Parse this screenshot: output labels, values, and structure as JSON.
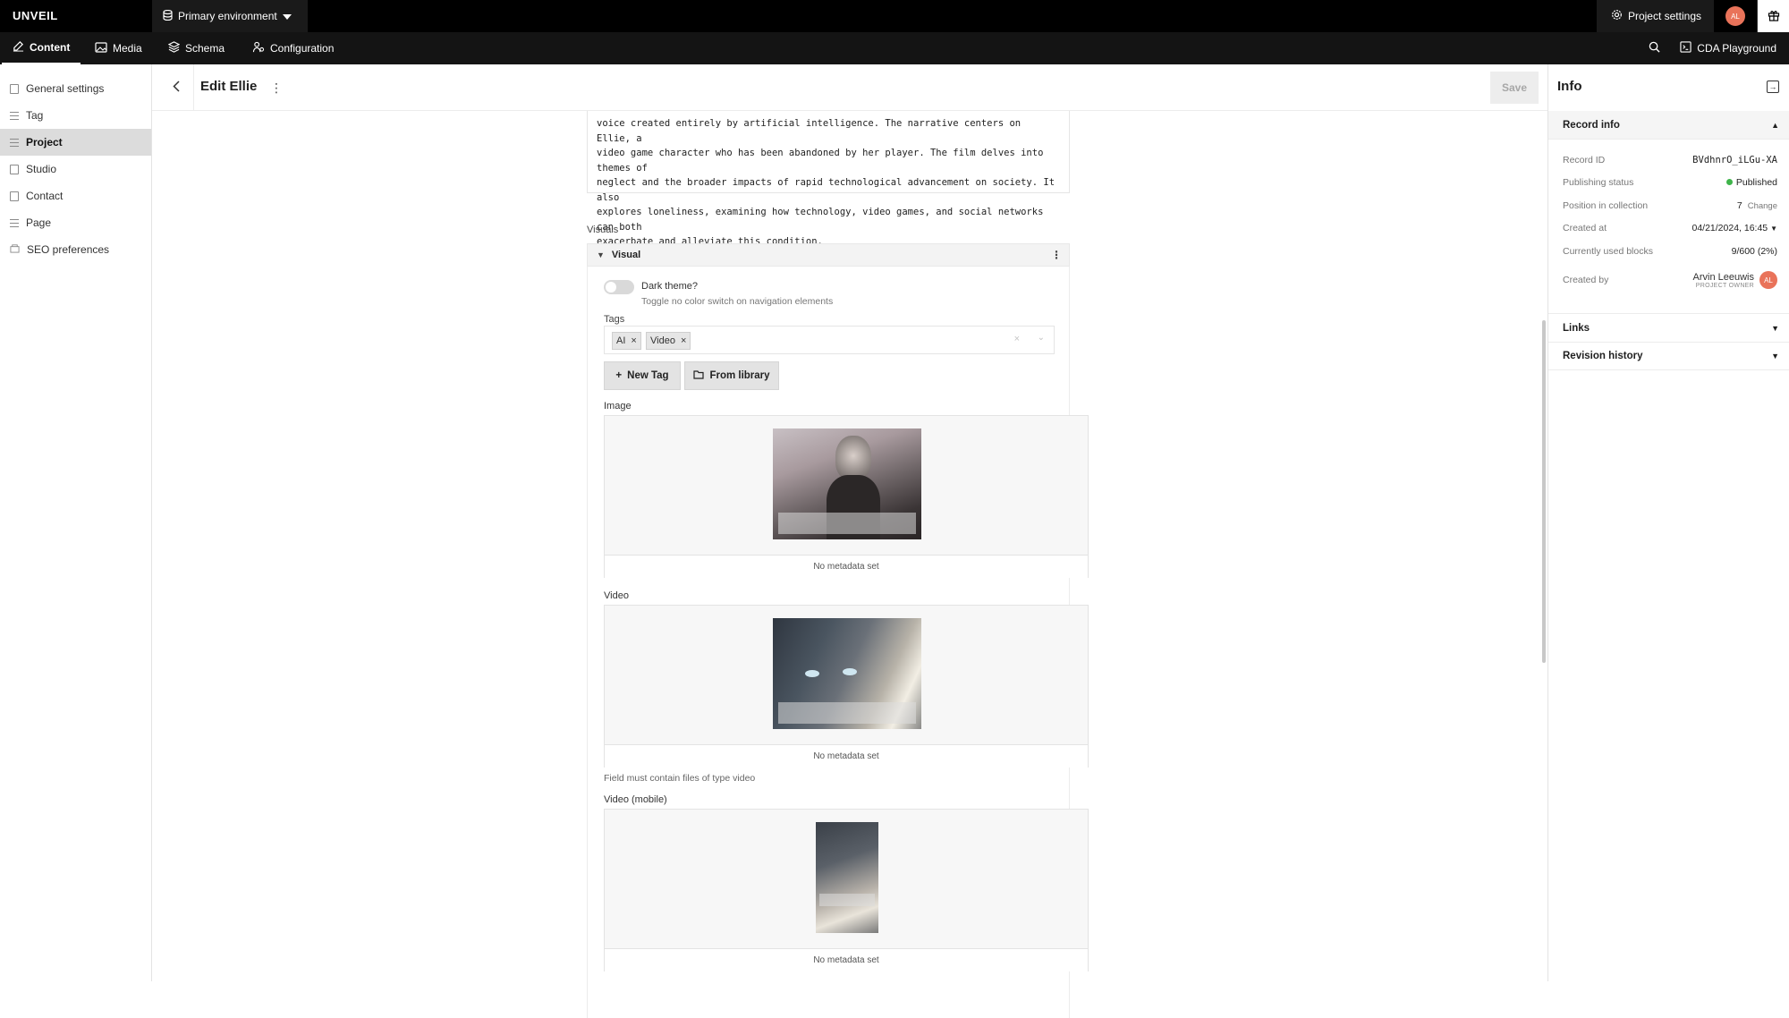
{
  "topbar": {
    "brand": "UNVEIL",
    "environment": "Primary environment",
    "project_settings": "Project settings",
    "avatar_initials": "AL"
  },
  "navbar": {
    "tabs": [
      {
        "label": "Content",
        "icon": "edit-icon"
      },
      {
        "label": "Media",
        "icon": "image-icon"
      },
      {
        "label": "Schema",
        "icon": "layers-icon"
      },
      {
        "label": "Configuration",
        "icon": "config-icon"
      }
    ],
    "cda": "CDA Playground"
  },
  "sidebar": {
    "items": [
      {
        "label": "General settings"
      },
      {
        "label": "Tag"
      },
      {
        "label": "Project"
      },
      {
        "label": "Studio"
      },
      {
        "label": "Contact"
      },
      {
        "label": "Page"
      },
      {
        "label": "SEO preferences"
      }
    ]
  },
  "editor": {
    "title": "Edit Ellie",
    "save": "Save",
    "description_text": "voice created entirely by artificial intelligence. The narrative centers on Ellie, a\nvideo game character who has been abandoned by her player. The film delves into themes of\nneglect and the broader impacts of rapid technological advancement on society. It also\nexplores loneliness, examining how technology, video games, and social networks can both\nexacerbate and alleviate this condition.",
    "visuals_label": "Visuals",
    "visual_block": "Visual",
    "dark_theme_label": "Dark theme?",
    "dark_theme_hint": "Toggle no color switch on navigation elements",
    "dark_theme_value": false,
    "tags_label": "Tags",
    "tags": [
      "AI",
      "Video"
    ],
    "new_tag": "New Tag",
    "from_library": "From library",
    "image_label": "Image",
    "image_meta": "No metadata set",
    "video_label": "Video",
    "video_meta": "No metadata set",
    "video_hint": "Field must contain files of type video",
    "video_mobile_label": "Video (mobile)",
    "video_mobile_meta": "No metadata set"
  },
  "info": {
    "title": "Info",
    "record_info": "Record info",
    "rows": {
      "record_id_k": "Record ID",
      "record_id_v": "BVdhnrO_iLGu-XA",
      "status_k": "Publishing status",
      "status_v": "Published",
      "position_k": "Position in collection",
      "position_v": "7",
      "position_change": "Change",
      "created_at_k": "Created at",
      "created_at_v": "04/21/2024, 16:45",
      "blocks_k": "Currently used blocks",
      "blocks_v": "9/600 (2%)",
      "created_by_k": "Created by",
      "created_by_name": "Arvin Leeuwis",
      "created_by_role": "PROJECT OWNER"
    },
    "links": "Links",
    "revision_history": "Revision history"
  },
  "colors": {
    "accent_avatar": "#e9735a",
    "published": "#3fb44a"
  }
}
